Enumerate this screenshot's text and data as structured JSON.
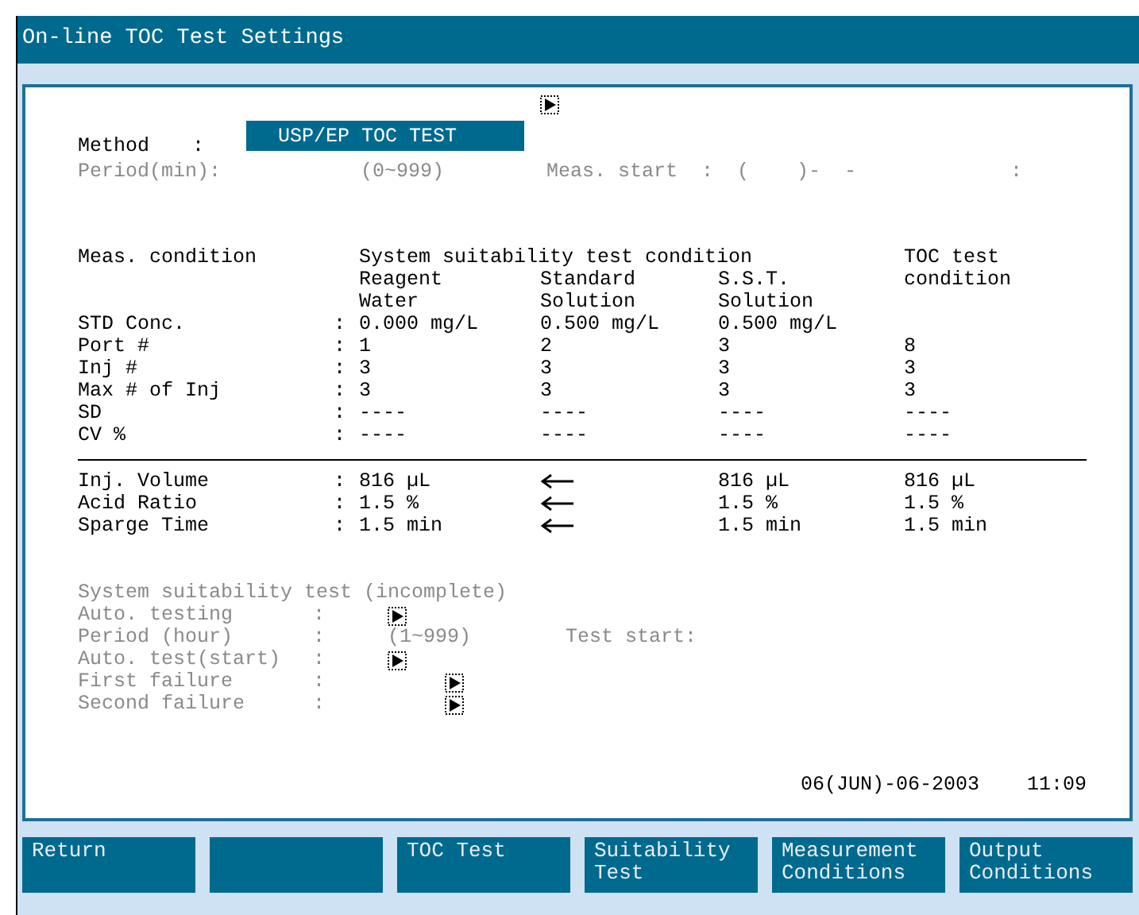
{
  "window": {
    "title": "On-line TOC Test Settings"
  },
  "method": {
    "label": "Method",
    "colon": ":",
    "value": "USP/EP TOC TEST",
    "selected": true
  },
  "period": {
    "label": "Period(min):",
    "range": "(0~999)",
    "meas_start": "Meas. start  :  (    )-  -",
    "meas_end": ":",
    "disabled": true
  },
  "table": {
    "label_heading": "Meas. condition",
    "group_heading": "System suitability test condition",
    "columns": [
      "Reagent\nWater",
      "Standard\nSolution",
      "S.S.T.\nSolution",
      "TOC test\ncondition"
    ],
    "rows": [
      {
        "label": "STD Conc.",
        "colon": ":",
        "cells": [
          {
            "kind": "text",
            "text": "0.000 mg/L"
          },
          {
            "kind": "text",
            "text": "0.500 mg/L"
          },
          {
            "kind": "text",
            "text": "0.500 mg/L"
          }
        ]
      },
      {
        "label": "Port #",
        "colon": ":",
        "cells": [
          {
            "kind": "text",
            "text": "1"
          },
          {
            "kind": "text",
            "text": "2"
          },
          {
            "kind": "text",
            "text": "3"
          },
          {
            "kind": "text",
            "text": "8"
          }
        ]
      },
      {
        "label": "Inj #",
        "colon": ":",
        "cells": [
          {
            "kind": "text",
            "text": "3"
          },
          {
            "kind": "text",
            "text": "3"
          },
          {
            "kind": "text",
            "text": "3"
          },
          {
            "kind": "text",
            "text": "3"
          }
        ]
      },
      {
        "label": "Max # of Inj",
        "colon": ":",
        "cells": [
          {
            "kind": "text",
            "text": "3"
          },
          {
            "kind": "text",
            "text": "3"
          },
          {
            "kind": "text",
            "text": "3"
          },
          {
            "kind": "text",
            "text": "3"
          }
        ]
      },
      {
        "label": "SD",
        "colon": ":",
        "cells": [
          {
            "kind": "text",
            "text": "----"
          },
          {
            "kind": "text",
            "text": "----"
          },
          {
            "kind": "text",
            "text": "----"
          },
          {
            "kind": "text",
            "text": "----"
          }
        ]
      },
      {
        "label": "CV %",
        "colon": ":",
        "cells": [
          {
            "kind": "text",
            "text": "----"
          },
          {
            "kind": "text",
            "text": "----"
          },
          {
            "kind": "text",
            "text": "----"
          },
          {
            "kind": "text",
            "text": "----"
          }
        ]
      }
    ],
    "lower_rows": [
      {
        "label": "Inj. Volume",
        "colon": ":",
        "cells": [
          {
            "kind": "text",
            "text": "816 µL"
          },
          {
            "kind": "arrow"
          },
          {
            "kind": "text",
            "text": "816 µL"
          },
          {
            "kind": "text",
            "text": "816 µL"
          }
        ]
      },
      {
        "label": "Acid Ratio",
        "colon": ":",
        "cells": [
          {
            "kind": "text",
            "text": "1.5 %"
          },
          {
            "kind": "arrow"
          },
          {
            "kind": "text",
            "text": "1.5 %"
          },
          {
            "kind": "text",
            "text": "1.5 %"
          }
        ]
      },
      {
        "label": "Sparge Time",
        "colon": ":",
        "cells": [
          {
            "kind": "text",
            "text": "1.5 min"
          },
          {
            "kind": "arrow"
          },
          {
            "kind": "text",
            "text": "1.5 min"
          },
          {
            "kind": "text",
            "text": "1.5 min"
          }
        ]
      }
    ]
  },
  "suitability": {
    "title": "System suitability test (incomplete)",
    "disabled": true,
    "rows": [
      {
        "label": "Auto. testing",
        "colon": ":",
        "kind": "picker"
      },
      {
        "label": "Period (hour)",
        "colon": ":",
        "kind": "range",
        "range": "(1~999)",
        "extra": "Test start:"
      },
      {
        "label": "Auto. test(start)",
        "colon": ":",
        "kind": "picker"
      },
      {
        "label": "First failure",
        "colon": ":",
        "kind": "far_picker"
      },
      {
        "label": "Second failure",
        "colon": ":",
        "kind": "far_picker"
      }
    ]
  },
  "date": "06(JUN)-06-2003",
  "time": "11:09",
  "function_keys": [
    {
      "kind": "key",
      "label": "Return"
    },
    {
      "kind": "blank"
    },
    {
      "kind": "key",
      "label": "TOC Test"
    },
    {
      "kind": "key",
      "label": "Suitability\nTest"
    },
    {
      "kind": "key",
      "label": "Measurement\nConditions"
    },
    {
      "kind": "key",
      "label": "Output\nConditions"
    }
  ]
}
